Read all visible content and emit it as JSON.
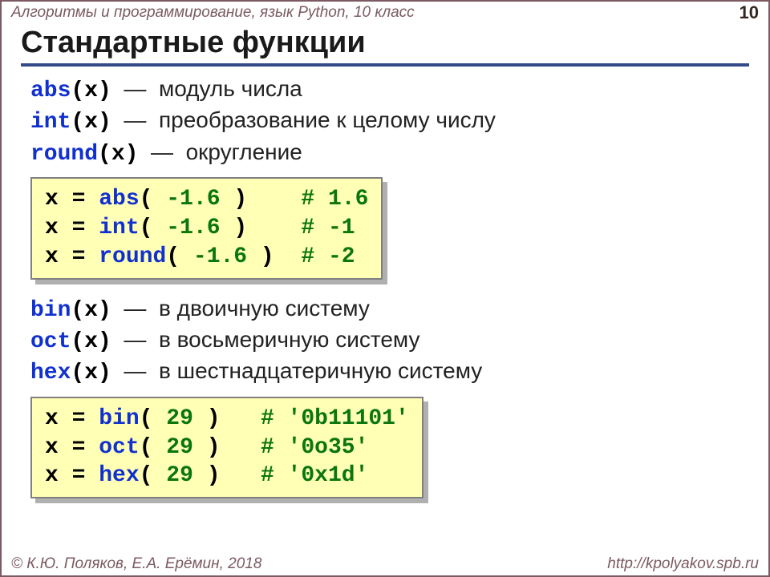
{
  "header": {
    "left": "Алгоритмы и программирование, язык Python, 10 класс",
    "page": "10"
  },
  "footer": {
    "left": "© К.Ю. Поляков, Е.А. Ерёмин, 2018",
    "right": "http://kpolyakov.spb.ru"
  },
  "title": "Стандартные функции",
  "defs1": {
    "abs_fn": "abs",
    "abs_arg": "(x)",
    "abs_dash": "—",
    "abs_desc": "модуль числа",
    "int_fn": "int",
    "int_arg": "(x)",
    "int_dash": "—",
    "int_desc": "преобразование к целому числу",
    "round_fn": "round",
    "round_arg": "(x)",
    "round_dash": "—",
    "round_desc": "округление"
  },
  "code1": {
    "l1a": "x",
    "l1b": "=",
    "l1c": "abs",
    "l1d": "(",
    "l1e": "-1.6",
    "l1f": ")",
    "l1pad": "    ",
    "l1g": "# 1.6",
    "l2a": "x",
    "l2b": "=",
    "l2c": "int",
    "l2d": "(",
    "l2e": "-1.6",
    "l2f": ")",
    "l2pad": "    ",
    "l2g": "# -1",
    "l3a": "x",
    "l3b": "=",
    "l3c": "round",
    "l3d": "(",
    "l3e": "-1.6",
    "l3f": ")",
    "l3pad": "  ",
    "l3g": "# -2"
  },
  "defs2": {
    "bin_fn": "bin",
    "bin_arg": "(x)",
    "bin_dash": "—",
    "bin_desc": "в двоичную систему",
    "oct_fn": "oct",
    "oct_arg": "(x)",
    "oct_dash": "—",
    "oct_desc": "в восьмеричную систему",
    "hex_fn": "hex",
    "hex_arg": "(x)",
    "hex_dash": "—",
    "hex_desc": "в шестнадцатеричную систему"
  },
  "code2": {
    "l1a": "x",
    "l1b": "=",
    "l1c": "bin",
    "l1d": "(",
    "l1e": "29",
    "l1f": ")",
    "l1pad": "   ",
    "l1g": "# '0b11101'",
    "l2a": "x",
    "l2b": "=",
    "l2c": "oct",
    "l2d": "(",
    "l2e": "29",
    "l2f": ")",
    "l2pad": "   ",
    "l2g": "# '0o35'",
    "l3a": "x",
    "l3b": "=",
    "l3c": "hex",
    "l3d": "(",
    "l3e": "29",
    "l3f": ")",
    "l3pad": "   ",
    "l3g": "# '0x1d'"
  }
}
